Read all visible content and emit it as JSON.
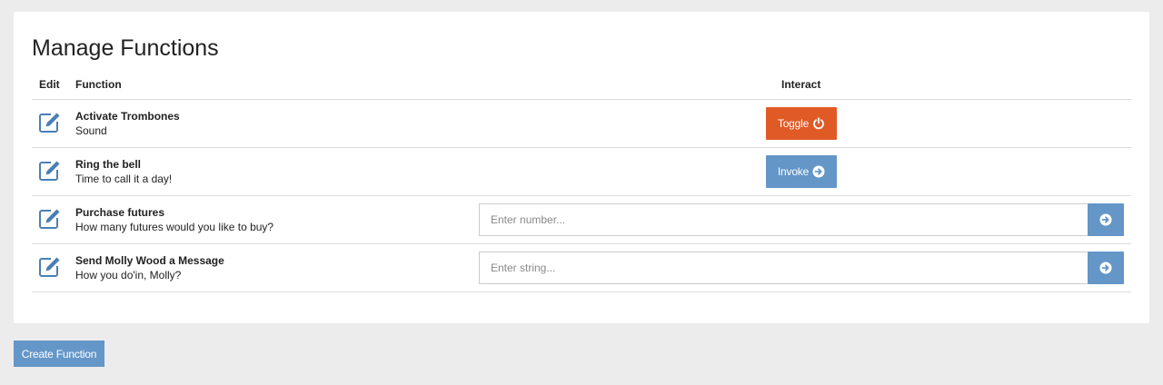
{
  "page_title": "Manage Functions",
  "table": {
    "headers": {
      "edit": "Edit",
      "function": "Function",
      "interact": "Interact"
    },
    "rows": [
      {
        "name": "Activate Trombones",
        "description": "Sound",
        "interact_type": "toggle",
        "button_label": "Toggle",
        "icon": "power-icon"
      },
      {
        "name": "Ring the bell",
        "description": "Time to call it a day!",
        "interact_type": "invoke",
        "button_label": "Invoke",
        "icon": "arrow-circle-right-icon"
      },
      {
        "name": "Purchase futures",
        "description": "How many futures would you like to buy?",
        "interact_type": "number-input",
        "placeholder": "Enter number...",
        "icon": "arrow-circle-right-icon"
      },
      {
        "name": "Send Molly Wood a Message",
        "description": "How you do'in, Molly?",
        "interact_type": "string-input",
        "placeholder": "Enter string...",
        "icon": "arrow-circle-right-icon"
      }
    ]
  },
  "create_button_label": "Create Function",
  "colors": {
    "background": "#ececec",
    "panel": "#ffffff",
    "toggle": "#e05a26",
    "primary": "#6496c8",
    "edit_icon": "#4a7fb5",
    "divider": "#dddddd"
  }
}
